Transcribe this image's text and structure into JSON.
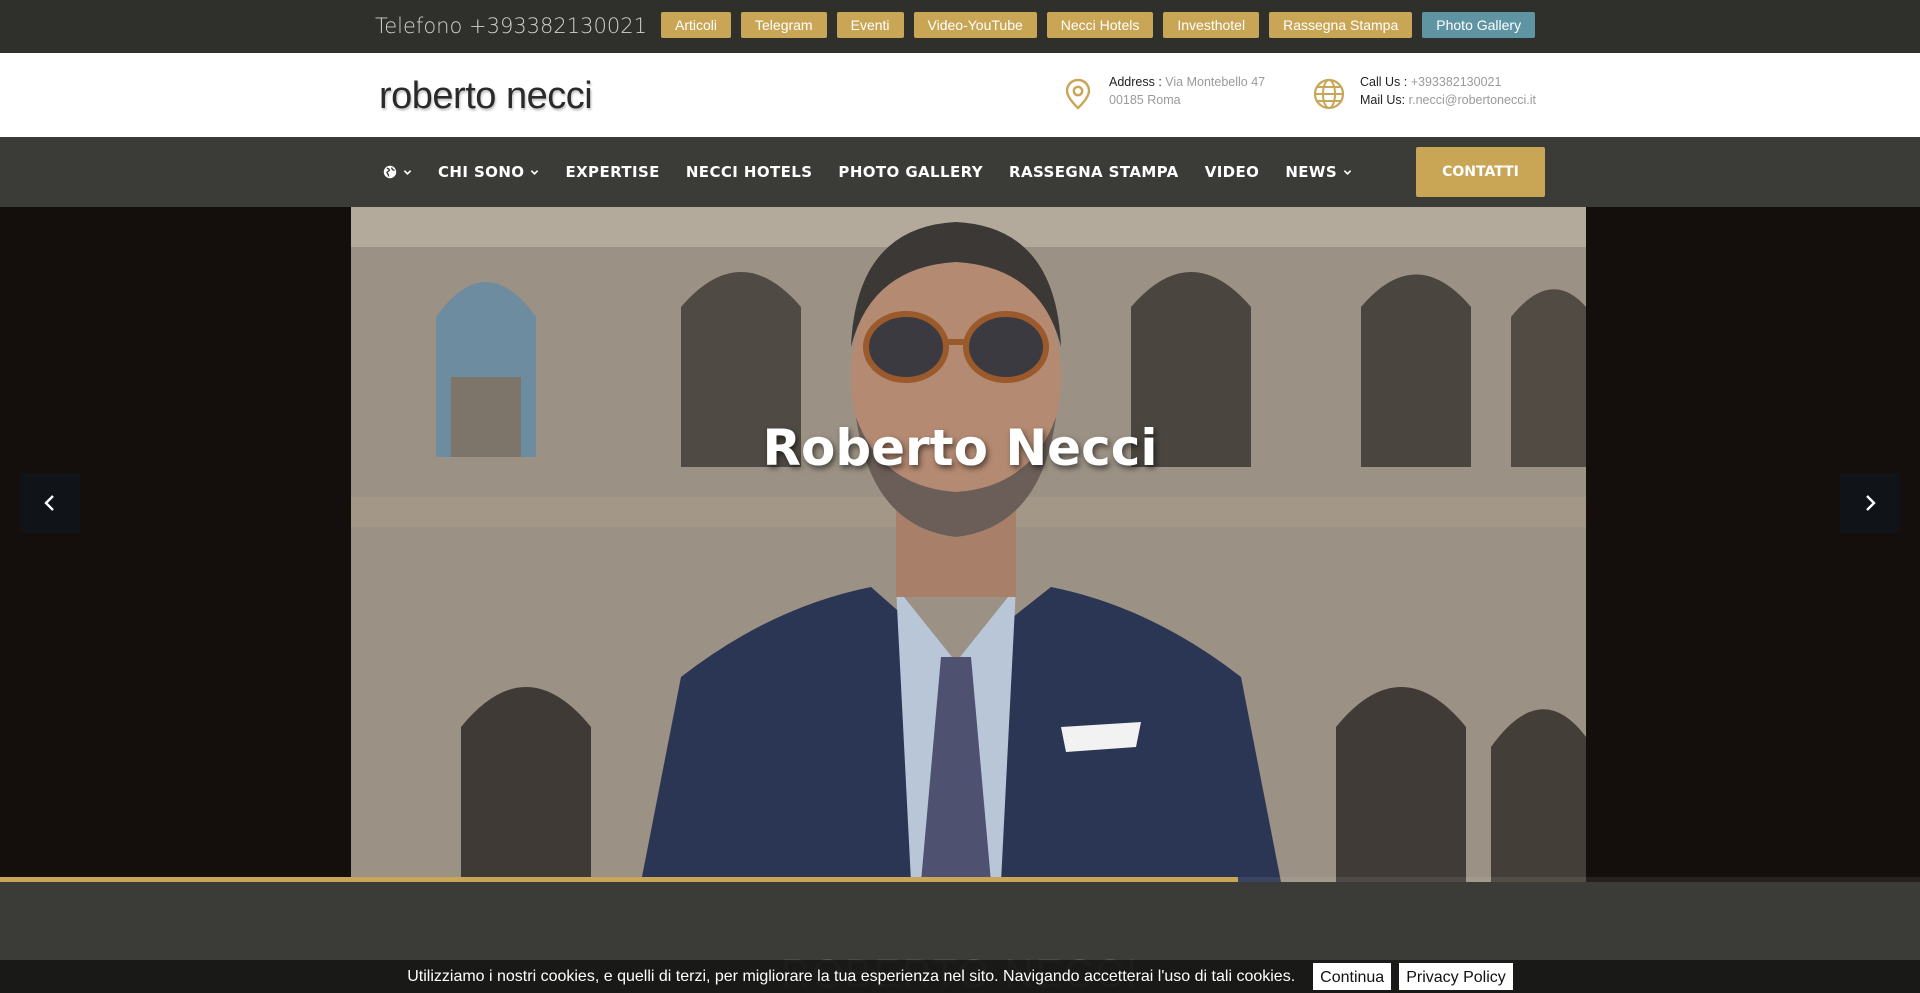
{
  "topbar": {
    "phone": "Telefono +393382130021",
    "links": [
      {
        "label": "Articoli"
      },
      {
        "label": "Telegram"
      },
      {
        "label": "Eventi"
      },
      {
        "label": "Video-YouTube"
      },
      {
        "label": "Necci Hotels"
      },
      {
        "label": "Investhotel"
      },
      {
        "label": "Rassegna Stampa"
      },
      {
        "label": "Photo Gallery"
      }
    ]
  },
  "header": {
    "logo": "roberto necci",
    "address": {
      "label": "Address :",
      "line1": "Via Montebello 47",
      "line2": "00185 Roma"
    },
    "contact": {
      "call_label": "Call Us :",
      "call_value": "+393382130021",
      "mail_label": "Mail Us:",
      "mail_value": "r.necci@robertonecci.it"
    }
  },
  "nav": {
    "items": [
      {
        "label": "CHI SONO"
      },
      {
        "label": "EXPERTISE"
      },
      {
        "label": "NECCI HOTELS"
      },
      {
        "label": "PHOTO GALLERY"
      },
      {
        "label": "RASSEGNA STAMPA"
      },
      {
        "label": "VIDEO"
      },
      {
        "label": "NEWS"
      }
    ],
    "cta": "CONTATTI"
  },
  "hero": {
    "title": "Roberto Necci",
    "progress_percent": 64.5
  },
  "section": {
    "title": "ROBERTO NECCI"
  },
  "cookie": {
    "text": "Utilizziamo i nostri cookies, e quelli di terzi, per migliorare la tua esperienza nel sito. Navigando accetterai l'uso di tali cookies.",
    "accept": "Continua",
    "policy": "Privacy Policy"
  },
  "colors": {
    "gold": "#c9a656",
    "teal": "#5f94a3",
    "dark": "#3b3c37"
  },
  "icons": {
    "address": "map-pin-icon",
    "contact": "globe-icon",
    "nav_language": "globe-icon",
    "prev": "chevron-left-icon",
    "next": "chevron-right-icon"
  }
}
